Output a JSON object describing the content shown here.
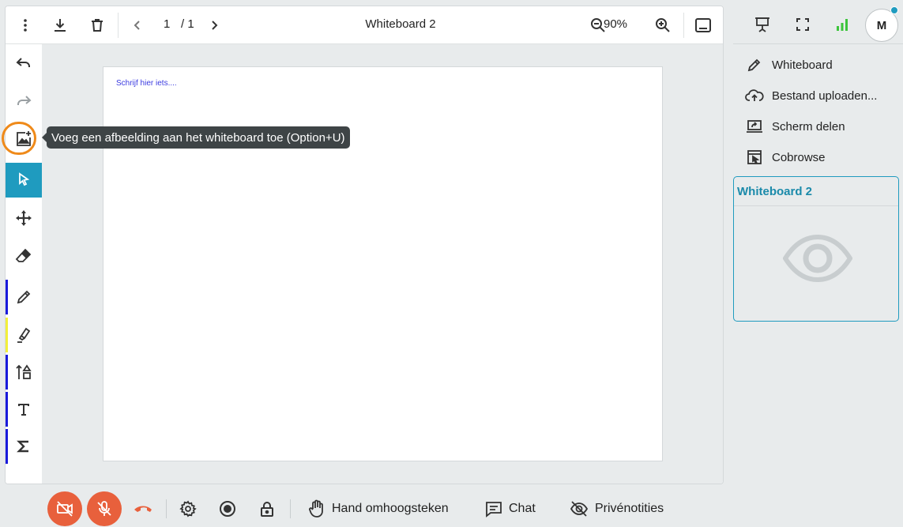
{
  "toolbar": {
    "page_current": "1",
    "page_total": "/ 1",
    "title": "Whiteboard 2",
    "zoom": "90%"
  },
  "canvas": {
    "placeholder": "Schrijf hier iets...."
  },
  "tools": [
    {
      "name": "undo-icon"
    },
    {
      "name": "redo-icon"
    },
    {
      "name": "add-image-icon"
    },
    {
      "name": "select-cursor-icon",
      "active": true
    },
    {
      "name": "move-icon"
    },
    {
      "name": "eraser-icon"
    },
    {
      "name": "pen-icon",
      "stripe_color": "#1a1adb"
    },
    {
      "name": "highlighter-icon",
      "stripe_color": "#f2ef3a"
    },
    {
      "name": "shapes-icon",
      "stripe_color": "#1a1adb"
    },
    {
      "name": "text-icon",
      "stripe_color": "#1a1adb"
    },
    {
      "name": "formula-icon",
      "stripe_color": "#1a1adb"
    }
  ],
  "tooltip": {
    "text": "Voeg een afbeelding aan het whiteboard toe (Option+U)"
  },
  "right_panel": {
    "avatar_initial": "M",
    "menu": [
      {
        "label": "Whiteboard",
        "icon": "pencil-icon"
      },
      {
        "label": "Bestand uploaden...",
        "icon": "cloud-upload-icon"
      },
      {
        "label": "Scherm delen",
        "icon": "screen-share-icon"
      },
      {
        "label": "Cobrowse",
        "icon": "cobrowse-icon"
      }
    ],
    "card": {
      "title": "Whiteboard 2",
      "icon": "eye-icon"
    }
  },
  "bottom_bar": {
    "hand_label": "Hand omhoogsteken",
    "chat_label": "Chat",
    "notes_label": "Privénotities"
  },
  "colors": {
    "accent": "#1f9bbf",
    "danger": "#e8603c",
    "highlight_ring": "#ef8a1a",
    "signal": "#3cc43c"
  }
}
